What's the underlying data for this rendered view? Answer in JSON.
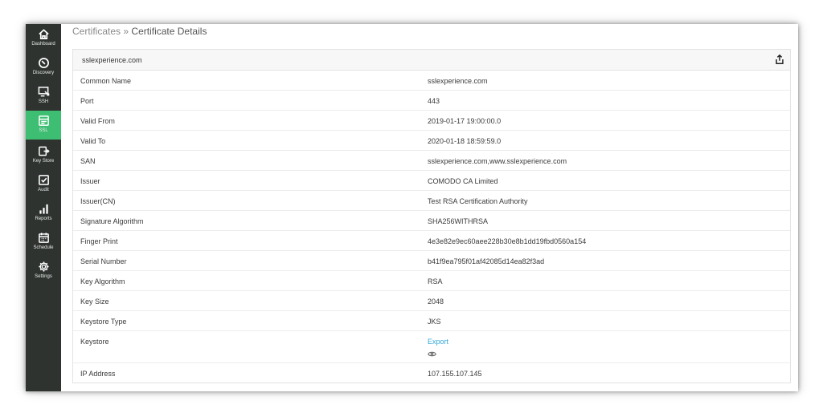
{
  "sidebar": {
    "items": [
      {
        "label": "Dashboard",
        "icon": "home-icon"
      },
      {
        "label": "Discovery",
        "icon": "compass-icon"
      },
      {
        "label": "SSH",
        "icon": "ssh-monitor-icon"
      },
      {
        "label": "SSL",
        "icon": "certificate-icon",
        "active": true
      },
      {
        "label": "Key Store",
        "icon": "key-store-icon"
      },
      {
        "label": "Audit",
        "icon": "audit-check-icon"
      },
      {
        "label": "Reports",
        "icon": "bar-chart-icon"
      },
      {
        "label": "Schedule",
        "icon": "calendar-icon"
      },
      {
        "label": "Settings",
        "icon": "gear-icon"
      }
    ]
  },
  "breadcrumb": {
    "parent": "Certificates",
    "separator": "»",
    "current": "Certificate Details"
  },
  "panel": {
    "title": "sslexperience.com",
    "rows": [
      {
        "key": "Common Name",
        "value": "sslexperience.com"
      },
      {
        "key": "Port",
        "value": "443"
      },
      {
        "key": "Valid From",
        "value": "2019-01-17 19:00:00.0"
      },
      {
        "key": "Valid To",
        "value": "2020-01-18 18:59:59.0"
      },
      {
        "key": "SAN",
        "value": "sslexperience.com,www.sslexperience.com"
      },
      {
        "key": "Issuer",
        "value": "COMODO CA Limited"
      },
      {
        "key": "Issuer(CN)",
        "value": "Test RSA Certification Authority"
      },
      {
        "key": "Signature Algorithm",
        "value": "SHA256WITHRSA"
      },
      {
        "key": "Finger Print",
        "value": "4e3e82e9ec60aee228b30e8b1dd19fbd0560a154"
      },
      {
        "key": "Serial Number",
        "value": "b41f9ea795f01af42085d14ea82f3ad"
      },
      {
        "key": "Key Algorithm",
        "value": "RSA"
      },
      {
        "key": "Key Size",
        "value": "2048"
      },
      {
        "key": "Keystore Type",
        "value": "JKS"
      },
      {
        "key": "Keystore",
        "link": "Export"
      },
      {
        "key": "IP Address",
        "value": "107.155.107.145"
      }
    ]
  },
  "colors": {
    "sidebar_bg": "#2f3330",
    "active_green": "#3dbe72",
    "link_blue": "#34a7d8"
  }
}
